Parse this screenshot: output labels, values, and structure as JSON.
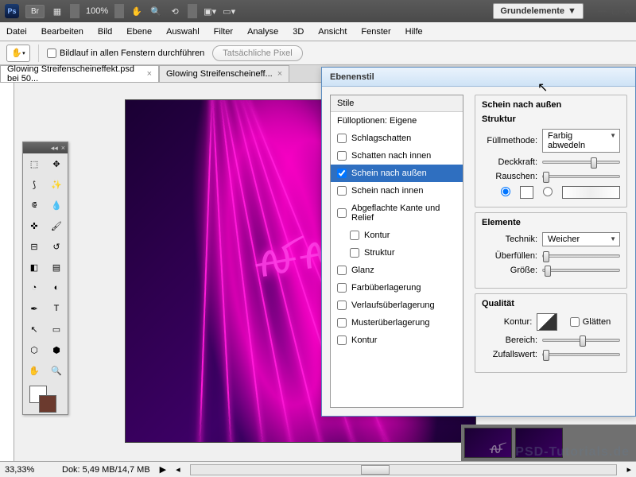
{
  "app": {
    "logo": "Ps",
    "zoom_pct": "100%",
    "workspace": "Grundelemente"
  },
  "menu": [
    "Datei",
    "Bearbeiten",
    "Bild",
    "Ebene",
    "Auswahl",
    "Filter",
    "Analyse",
    "3D",
    "Ansicht",
    "Fenster",
    "Hilfe"
  ],
  "options": {
    "scroll_all": "Bildlauf in allen Fenstern durchführen",
    "actual_px": "Tatsächliche Pixel"
  },
  "tabs": [
    {
      "label": "Glowing Streifenscheineffekt.psd bei 50..."
    },
    {
      "label": "Glowing Streifenscheineff..."
    }
  ],
  "dialog": {
    "title": "Ebenenstil",
    "list_header": "Stile",
    "items": [
      {
        "label": "Fülloptionen: Eigene",
        "checkbox": false
      },
      {
        "label": "Schlagschatten",
        "checkbox": true,
        "checked": false
      },
      {
        "label": "Schatten nach innen",
        "checkbox": true,
        "checked": false
      },
      {
        "label": "Schein nach außen",
        "checkbox": true,
        "checked": true,
        "selected": true
      },
      {
        "label": "Schein nach innen",
        "checkbox": true,
        "checked": false
      },
      {
        "label": "Abgeflachte Kante und Relief",
        "checkbox": true,
        "checked": false
      },
      {
        "label": "Kontur",
        "checkbox": true,
        "checked": false,
        "indent": true
      },
      {
        "label": "Struktur",
        "checkbox": true,
        "checked": false,
        "indent": true
      },
      {
        "label": "Glanz",
        "checkbox": true,
        "checked": false
      },
      {
        "label": "Farbüberlagerung",
        "checkbox": true,
        "checked": false
      },
      {
        "label": "Verlaufsüberlagerung",
        "checkbox": true,
        "checked": false
      },
      {
        "label": "Musterüberlagerung",
        "checkbox": true,
        "checked": false
      },
      {
        "label": "Kontur",
        "checkbox": true,
        "checked": false
      }
    ],
    "right": {
      "title": "Schein nach außen",
      "struct": {
        "heading": "Struktur",
        "blend_label": "Füllmethode:",
        "blend_value": "Farbig abwedeln",
        "opacity_label": "Deckkraft:",
        "noise_label": "Rauschen:"
      },
      "elements": {
        "heading": "Elemente",
        "technique_label": "Technik:",
        "technique_value": "Weicher",
        "spread_label": "Überfüllen:",
        "size_label": "Größe:"
      },
      "quality": {
        "heading": "Qualität",
        "contour_label": "Kontur:",
        "antialias_label": "Glätten",
        "range_label": "Bereich:",
        "jitter_label": "Zufallswert:"
      }
    }
  },
  "status": {
    "zoom": "33,33%",
    "doc": "Dok: 5,49 MB/14,7 MB"
  },
  "watermark": "PSD-Tutorials.de"
}
